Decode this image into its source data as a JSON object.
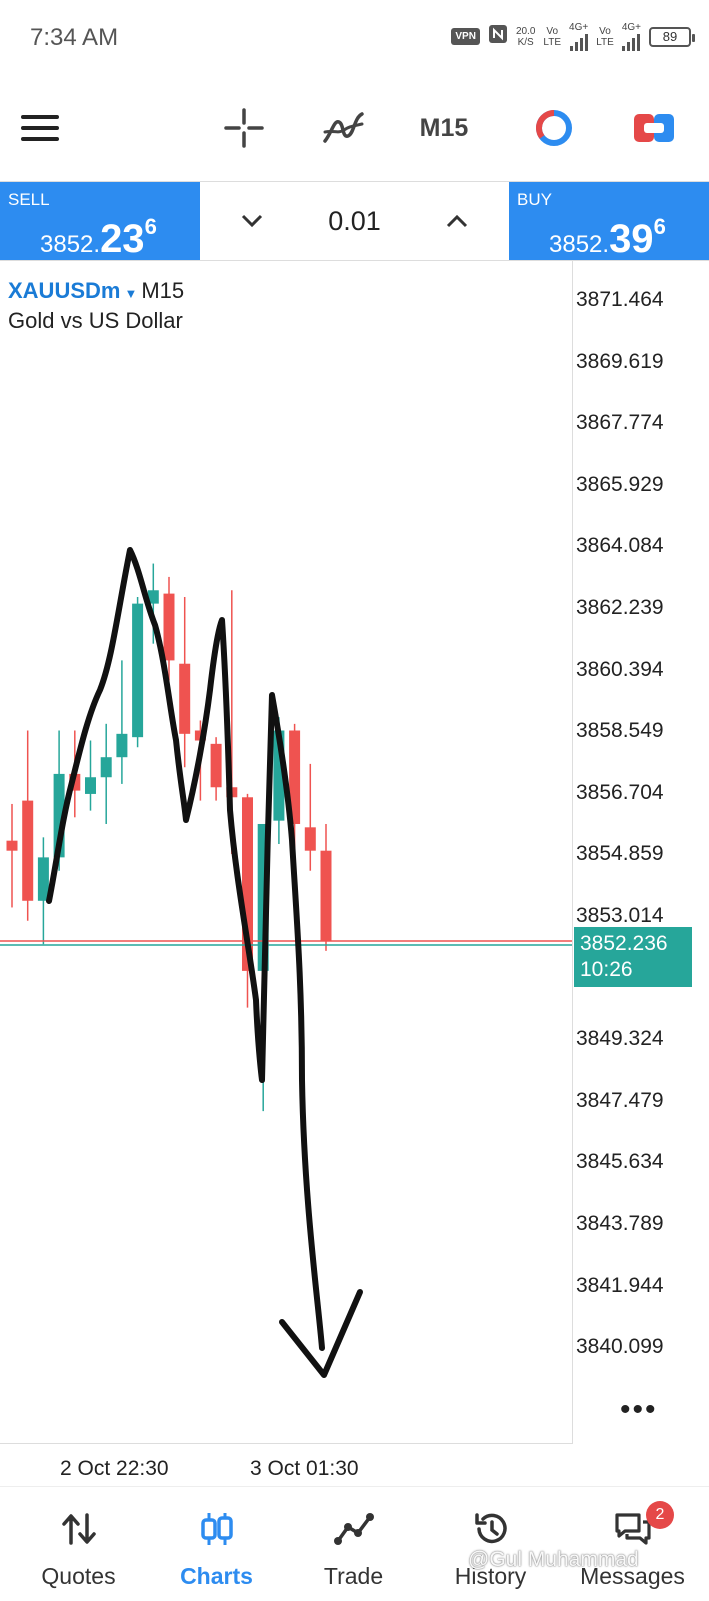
{
  "statusbar": {
    "time": "7:34 AM",
    "vpn_label": "VPN",
    "speed_value": "20.0",
    "speed_unit": "K/S",
    "sim1": {
      "top": "Vo",
      "bottom": "LTE",
      "net": "4G+"
    },
    "sim2": {
      "top": "Vo",
      "bottom": "LTE",
      "net": "4G+"
    },
    "battery": "89",
    "icons": [
      "vpn-icon",
      "nfc-icon",
      "signal-icon",
      "battery-icon"
    ]
  },
  "toolbar": {
    "timeframe_label": "M15",
    "icons": [
      "menu-icon",
      "crosshair-icon",
      "indicators-icon",
      "timeframe",
      "chart-style-icon",
      "trade-toggle-icon"
    ]
  },
  "trade": {
    "sell_label": "SELL",
    "sell_price_main": "3852.",
    "sell_price_big": "23",
    "sell_price_sup": "6",
    "buy_label": "BUY",
    "buy_price_main": "3852.",
    "buy_price_big": "39",
    "buy_price_sup": "6",
    "lot": "0.01",
    "decrease_icon": "chevron-down-icon",
    "increase_icon": "chevron-up-icon"
  },
  "chart": {
    "symbol": "XAUUSDm",
    "timeframe": "M15",
    "description": "Gold vs US Dollar",
    "price_ticks": [
      "3871.464",
      "3869.619",
      "3867.774",
      "3865.929",
      "3864.084",
      "3862.239",
      "3860.394",
      "3858.549",
      "3856.704",
      "3854.859",
      "3853.014",
      "3849.324",
      "3847.479",
      "3845.634",
      "3843.789",
      "3841.944",
      "3840.099"
    ],
    "current_price": "3852.236",
    "bar_timer": "10:26",
    "time_labels": [
      "2 Oct 22:30",
      "3 Oct 01:30"
    ],
    "colors": {
      "bull": "#26a69a",
      "bear": "#ef5350",
      "bid_line": "#26a69a",
      "ask_line": "#ef5350"
    },
    "candles": [
      {
        "o": 3855.3,
        "h": 3856.4,
        "l": 3853.3,
        "c": 3855.0
      },
      {
        "o": 3856.5,
        "h": 3858.6,
        "l": 3852.9,
        "c": 3853.5
      },
      {
        "o": 3853.5,
        "h": 3855.4,
        "l": 3852.2,
        "c": 3854.8
      },
      {
        "o": 3854.8,
        "h": 3858.6,
        "l": 3854.4,
        "c": 3857.3
      },
      {
        "o": 3857.3,
        "h": 3858.6,
        "l": 3856.0,
        "c": 3856.8
      },
      {
        "o": 3856.7,
        "h": 3858.3,
        "l": 3856.2,
        "c": 3857.2
      },
      {
        "o": 3857.2,
        "h": 3858.8,
        "l": 3855.8,
        "c": 3857.8
      },
      {
        "o": 3857.8,
        "h": 3860.7,
        "l": 3857.0,
        "c": 3858.5
      },
      {
        "o": 3858.4,
        "h": 3862.6,
        "l": 3858.1,
        "c": 3862.4
      },
      {
        "o": 3862.4,
        "h": 3863.6,
        "l": 3861.2,
        "c": 3862.8
      },
      {
        "o": 3862.7,
        "h": 3863.2,
        "l": 3860.1,
        "c": 3860.7
      },
      {
        "o": 3860.6,
        "h": 3862.6,
        "l": 3857.5,
        "c": 3858.5
      },
      {
        "o": 3858.6,
        "h": 3858.9,
        "l": 3856.5,
        "c": 3858.3
      },
      {
        "o": 3858.2,
        "h": 3858.4,
        "l": 3856.5,
        "c": 3856.9
      },
      {
        "o": 3856.9,
        "h": 3862.8,
        "l": 3854.9,
        "c": 3856.6
      },
      {
        "o": 3856.6,
        "h": 3856.7,
        "l": 3850.3,
        "c": 3851.4
      },
      {
        "o": 3851.4,
        "h": 3853.0,
        "l": 3847.2,
        "c": 3855.8
      },
      {
        "o": 3855.9,
        "h": 3859.0,
        "l": 3855.2,
        "c": 3858.6
      },
      {
        "o": 3858.6,
        "h": 3858.8,
        "l": 3854.6,
        "c": 3855.8
      },
      {
        "o": 3855.7,
        "h": 3857.6,
        "l": 3854.4,
        "c": 3855.0
      },
      {
        "o": 3855.0,
        "h": 3855.8,
        "l": 3852.0,
        "c": 3852.3
      }
    ]
  },
  "nav": [
    {
      "label": "Quotes",
      "icon": "quotes-icon",
      "active": false
    },
    {
      "label": "Charts",
      "icon": "charts-icon",
      "active": true
    },
    {
      "label": "Trade",
      "icon": "trade-icon",
      "active": false
    },
    {
      "label": "History",
      "icon": "history-icon",
      "active": false
    },
    {
      "label": "Messages",
      "icon": "messages-icon",
      "active": false,
      "badge": "2"
    }
  ],
  "watermark": "@Gul Muhammad"
}
